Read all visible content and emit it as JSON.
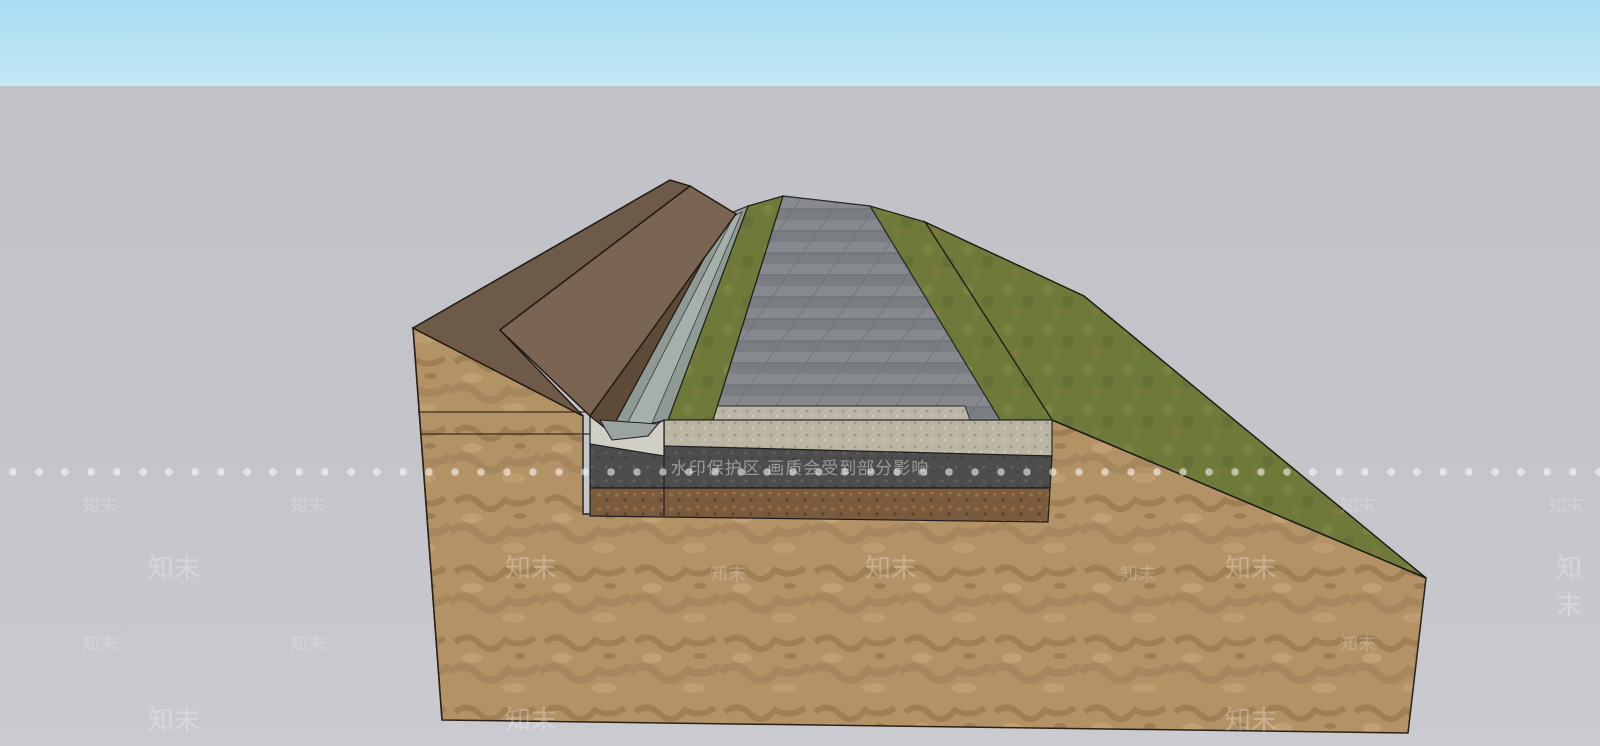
{
  "watermark": {
    "banner": "水印保护区  画质会受到部分影响",
    "brand": "知末"
  },
  "colors": {
    "sky": "#b6e1f4",
    "ground_plane": "#c3c4c9",
    "soil": "#b08f62",
    "berm_side": "#6b5847",
    "berm_top": "#7a6553",
    "grass": "#6f7a3c",
    "paving": "#7b7f84",
    "gravel": "#bdb8a6",
    "base_course": "#4c4c4c",
    "subgrade": "#7a5a3c"
  }
}
